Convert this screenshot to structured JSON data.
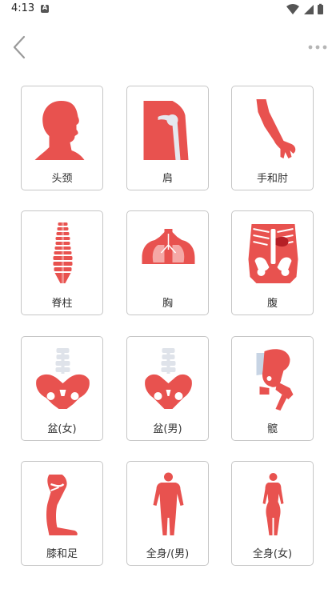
{
  "status": {
    "time": "4:13",
    "notification_letter": "A"
  },
  "colors": {
    "accent": "#e8524f",
    "bone": "#dfe3ea",
    "card_border": "#c6c6c6"
  },
  "cards": [
    {
      "label": "头颈",
      "icon": "head-neck-icon"
    },
    {
      "label": "肩",
      "icon": "shoulder-icon"
    },
    {
      "label": "手和肘",
      "icon": "hand-elbow-icon"
    },
    {
      "label": "脊柱",
      "icon": "spine-icon"
    },
    {
      "label": "胸",
      "icon": "chest-icon"
    },
    {
      "label": "腹",
      "icon": "abdomen-icon"
    },
    {
      "label": "盆(女)",
      "icon": "pelvis-female-icon"
    },
    {
      "label": "盆(男)",
      "icon": "pelvis-male-icon"
    },
    {
      "label": "髋",
      "icon": "hip-icon"
    },
    {
      "label": "膝和足",
      "icon": "knee-foot-icon"
    },
    {
      "label": "全身/(男)",
      "icon": "full-body-male-icon"
    },
    {
      "label": "全身(女)",
      "icon": "full-body-female-icon"
    }
  ]
}
